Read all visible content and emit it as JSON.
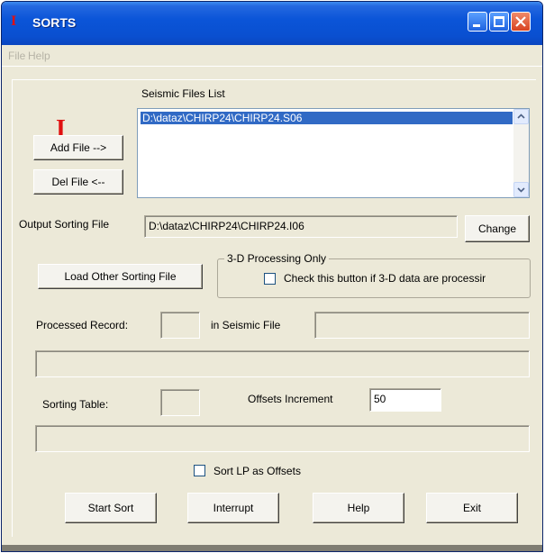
{
  "window": {
    "title": "SORTS",
    "accent": "#0a4fd0",
    "close_color": "#d84220",
    "logo_color": "#e01010"
  },
  "menu": {
    "items": [
      "File",
      "Help"
    ]
  },
  "files": {
    "list_label": "Seismic Files List",
    "items": [
      "D:\\dataz\\CHIRP24\\CHIRP24.S06"
    ],
    "add_label": "Add File -->",
    "del_label": "Del File <--"
  },
  "output": {
    "label": "Output Sorting File",
    "value": "D:\\dataz\\CHIRP24\\CHIRP24.I06",
    "change_label": "Change"
  },
  "load_other_label": "Load Other Sorting File",
  "three_d": {
    "group_label": "3-D Processing Only",
    "check_label": "Check this button if 3-D data are processir",
    "checked": false
  },
  "processed": {
    "label": "Processed Record:",
    "record_value": "",
    "in_file_label": "in Seismic File",
    "file_value": ""
  },
  "sorting": {
    "table_label": "Sorting Table:",
    "table_value": "",
    "offsets_label": "Offsets Increment",
    "offsets_value": "50"
  },
  "sort_lp": {
    "label": "Sort LP as Offsets",
    "checked": false
  },
  "buttons": {
    "start": "Start Sort",
    "interrupt": "Interrupt",
    "help": "Help",
    "exit": "Exit"
  }
}
